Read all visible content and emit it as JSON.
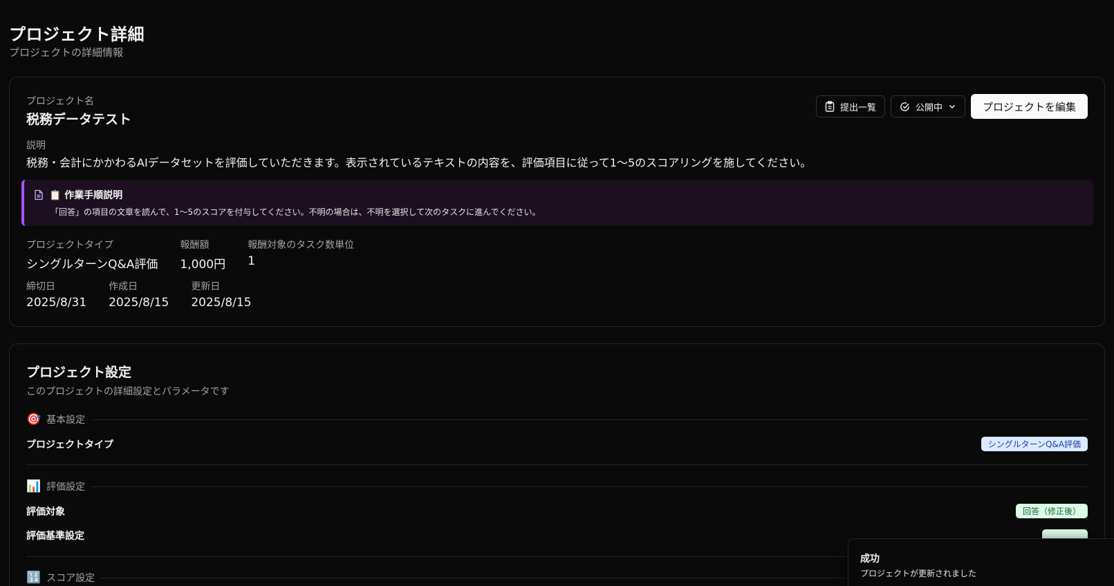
{
  "page": {
    "title": "プロジェクト詳細",
    "subtitle": "プロジェクトの詳細情報"
  },
  "project": {
    "name_label": "プロジェクト名",
    "name": "税務データテスト",
    "description_label": "説明",
    "description": "税務・会計にかかわるAIデータセットを評価していただきます。表示されているテキストの内容を、評価項目に従って1〜5のスコアリングを施してください。",
    "instructions": {
      "title": "📋 作業手順説明",
      "text": "「回答」の項目の文章を読んで、1〜5のスコアを付与してください。不明の場合は、不明を選択して次のタスクに進んでください。"
    },
    "meta_row1": [
      {
        "label": "プロジェクトタイプ",
        "value": "シングルターンQ&A評価"
      },
      {
        "label": "報酬額",
        "value": "1,000円"
      },
      {
        "label": "報酬対象のタスク数単位",
        "value": "1"
      }
    ],
    "meta_row2": [
      {
        "label": "締切日",
        "value": "2025/8/31"
      },
      {
        "label": "作成日",
        "value": "2025/8/15"
      },
      {
        "label": "更新日",
        "value": "2025/8/15"
      }
    ]
  },
  "actions": {
    "submissions_label": "提出一覧",
    "status_label": "公開中",
    "edit_label": "プロジェクトを編集"
  },
  "settings": {
    "title": "プロジェクト設定",
    "subtitle": "このプロジェクトの詳細設定とパラメータです",
    "basic": {
      "emoji": "🎯",
      "title": "基本設定",
      "rows": [
        {
          "label": "プロジェクトタイプ",
          "badge": "シングルターンQ&A評価"
        }
      ]
    },
    "eval": {
      "emoji": "📊",
      "title": "評価設定",
      "rows": [
        {
          "label": "評価対象",
          "badge": "回答（修正後）"
        },
        {
          "label": "評価基準設定",
          "badge": ""
        }
      ]
    },
    "score": {
      "emoji": "🔢",
      "title": "スコア設定"
    }
  },
  "toast": {
    "title": "成功",
    "message": "プロジェクトが更新されました"
  },
  "colors": {
    "background": "#0a0a0a",
    "accent_purple": "#a855f7",
    "badge_blue_bg": "#dbeafe",
    "badge_green_bg": "#dcfce7"
  }
}
